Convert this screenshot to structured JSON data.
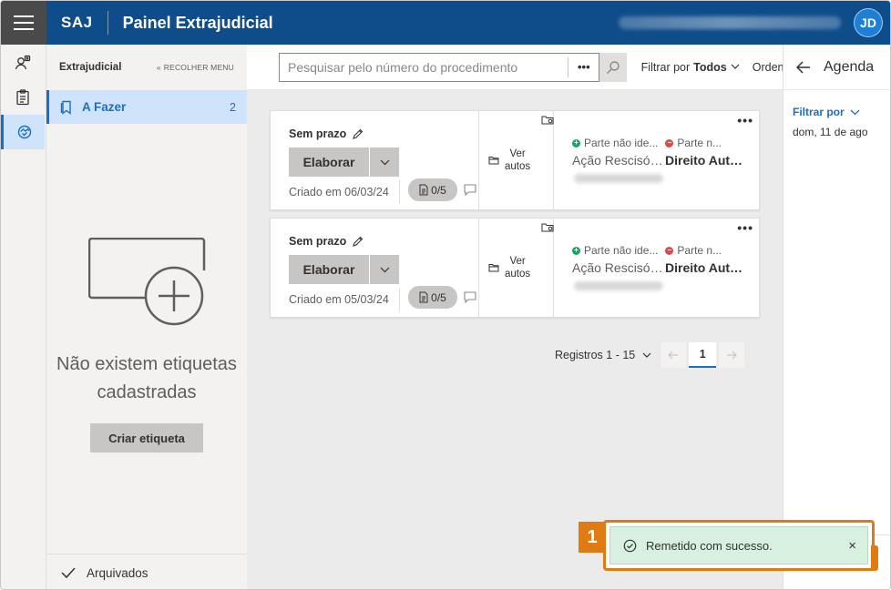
{
  "header": {
    "brand": "SAJ",
    "title": "Painel Extrajudicial",
    "user_initials": "JD"
  },
  "rail": {
    "items": [
      {
        "icon": "person-search-icon"
      },
      {
        "icon": "clipboard-icon"
      },
      {
        "icon": "handshake-icon"
      }
    ]
  },
  "sidebar": {
    "title": "Extrajudicial",
    "collapse_label": "RECOLHER MENU",
    "items": [
      {
        "label": "A Fazer",
        "count": "2"
      }
    ],
    "empty_text": "Não existem etiquetas cadastradas",
    "create_button": "Criar etiqueta",
    "archived_label": "Arquivados"
  },
  "toolbar": {
    "search_placeholder": "Pesquisar pelo número do procedimento",
    "more_label": "•••",
    "filter_label": "Filtrar por",
    "filter_value": "Todos",
    "order_label": "Ordenar"
  },
  "cards": [
    {
      "deadline": "Sem prazo",
      "action": "Elaborar",
      "created": "Criado em 06/03/24",
      "docs": "0/5",
      "view_line1": "Ver",
      "view_line2": "autos",
      "part1": "Parte não ide...",
      "part2": "Parte n...",
      "subject1": "Ação Rescisória",
      "subject2": "Direito Autoral"
    },
    {
      "deadline": "Sem prazo",
      "action": "Elaborar",
      "created": "Criado em 05/03/24",
      "docs": "0/5",
      "view_line1": "Ver",
      "view_line2": "autos",
      "part1": "Parte não ide...",
      "part2": "Parte n...",
      "subject1": "Ação Rescisória",
      "subject2": "Direito Autoral"
    }
  ],
  "pager": {
    "records": "Registros 1 - 15",
    "current_page": "1"
  },
  "agenda": {
    "title": "Agenda",
    "filter_label": "Filtrar por",
    "date": "dom, 11 de ago"
  },
  "toast": {
    "step": "1",
    "message": "Remetido com sucesso.",
    "close": "×"
  },
  "colors": {
    "header_bg": "#0f4c8a",
    "accent": "#1a6fc4",
    "toast_bg": "#d8f0df",
    "highlight": "#e07b14"
  }
}
